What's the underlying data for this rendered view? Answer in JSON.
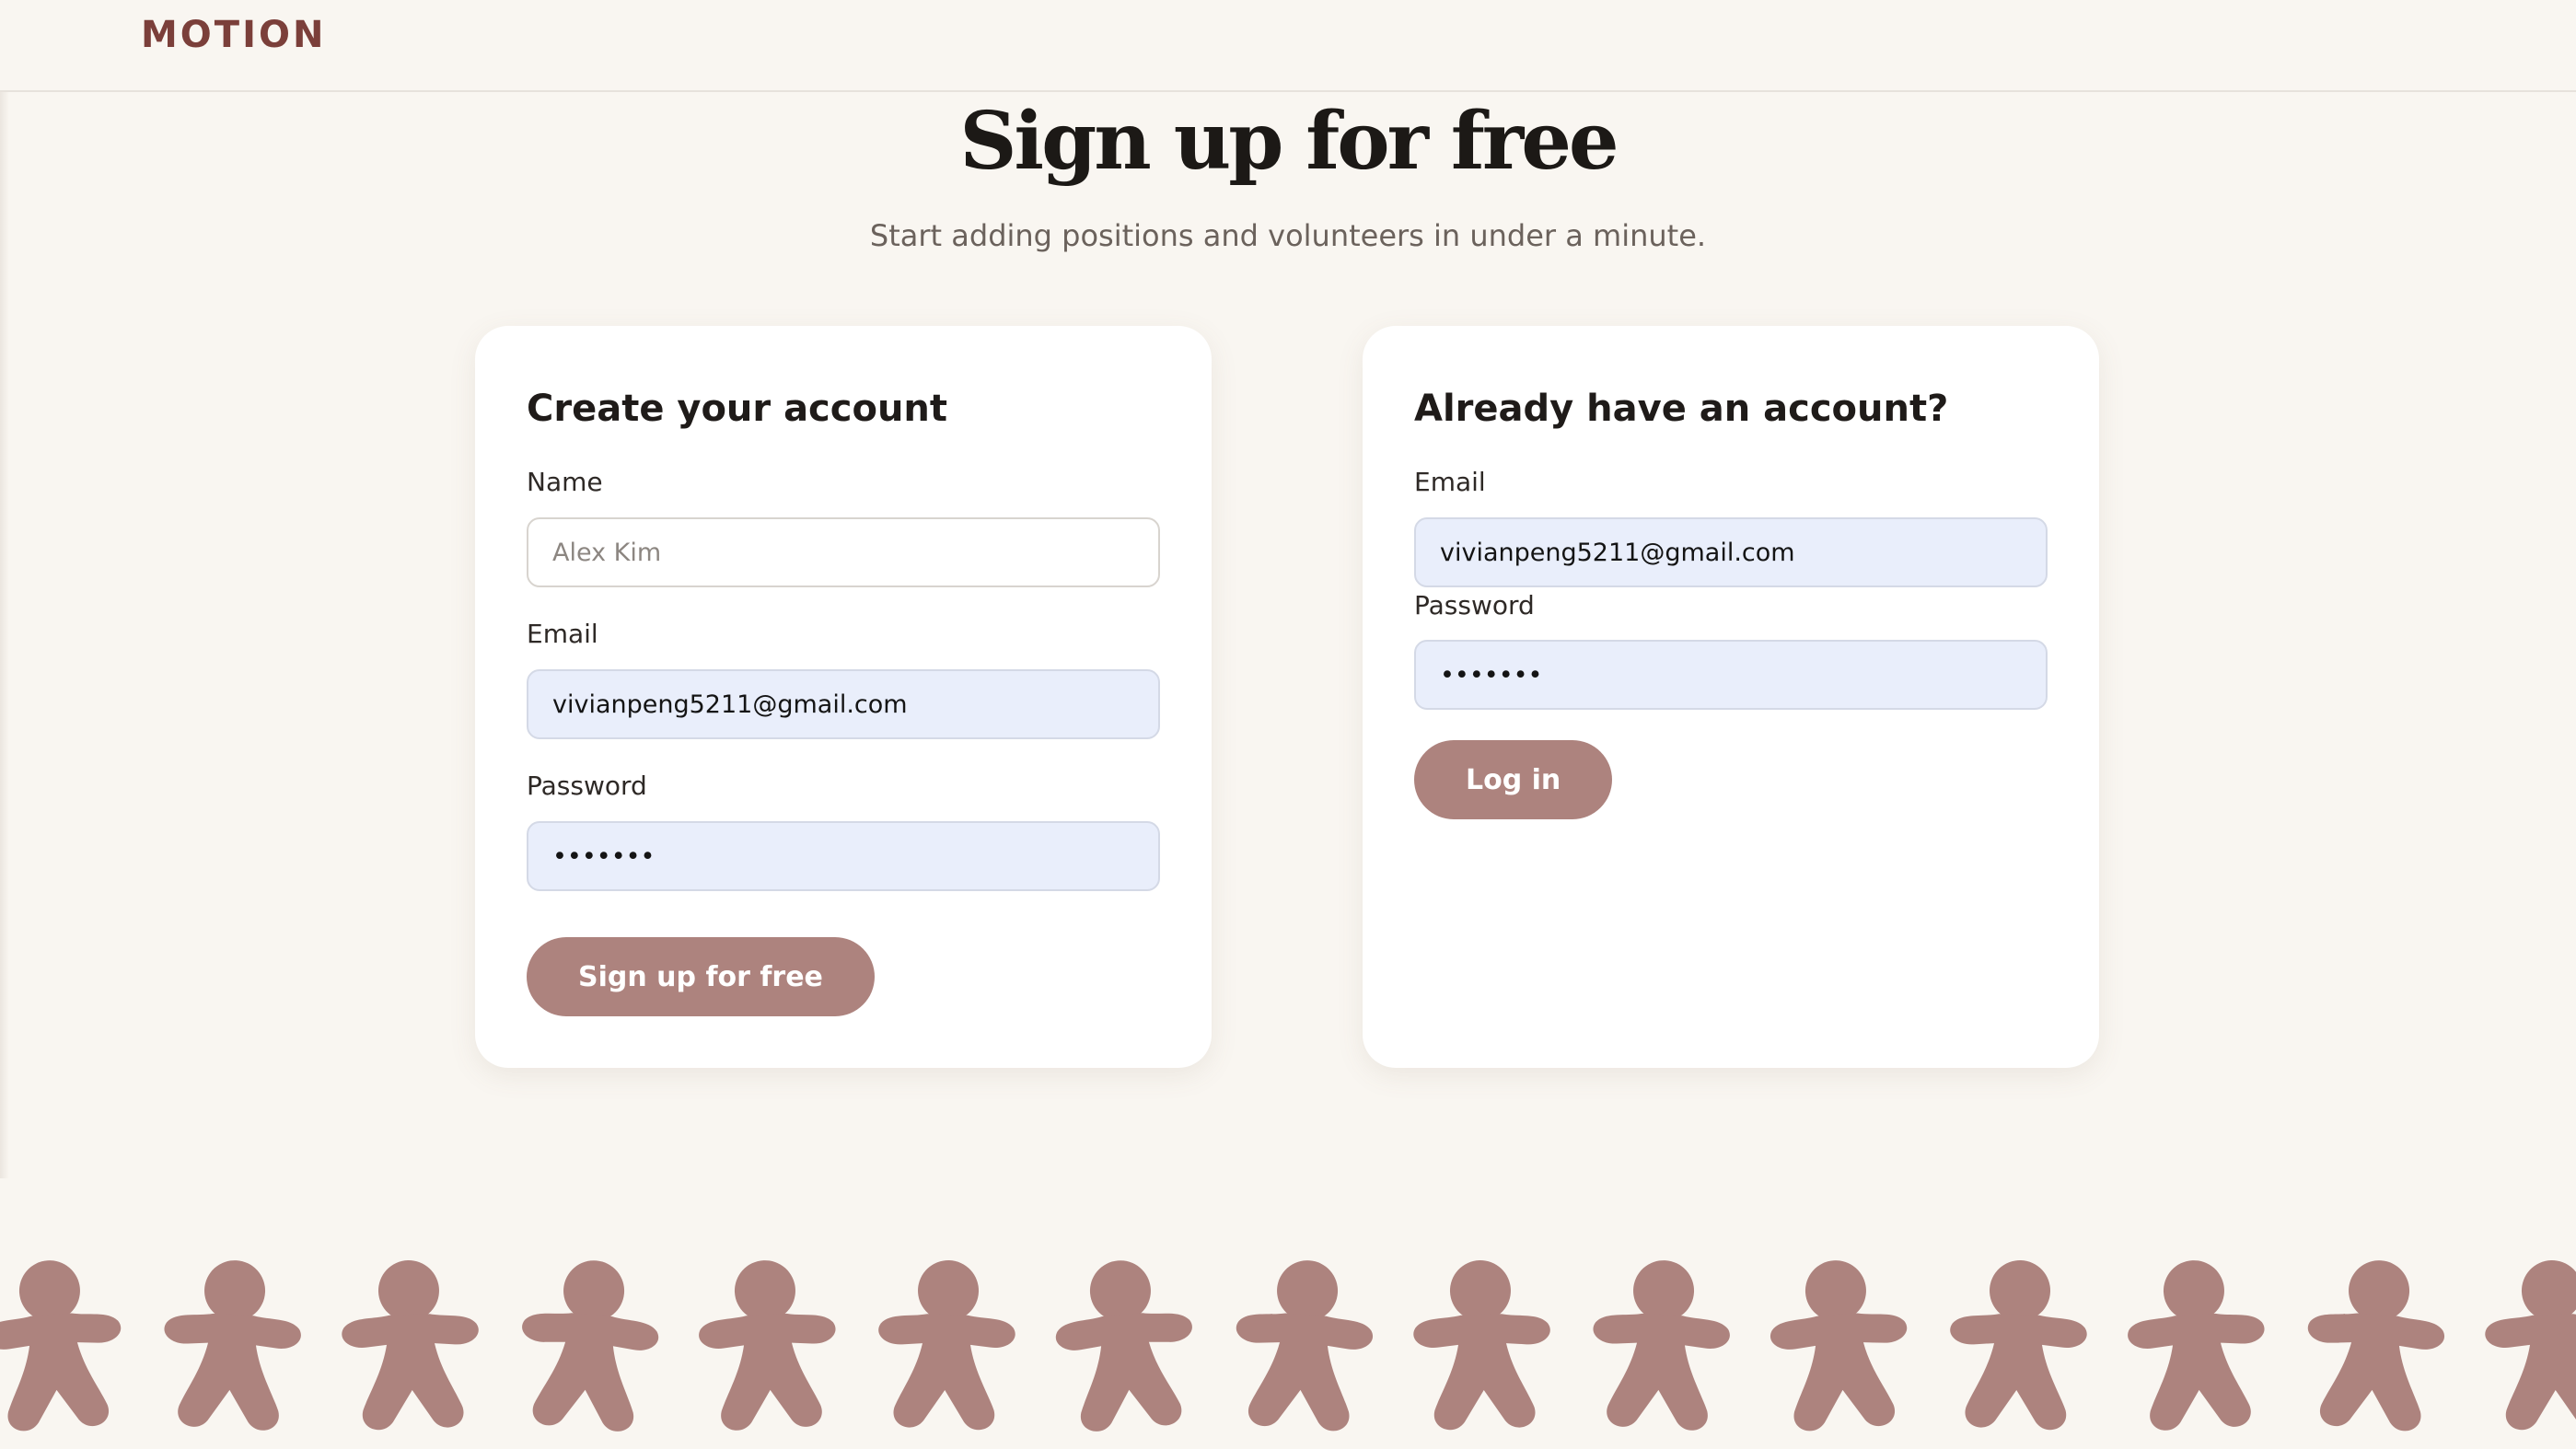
{
  "brand": {
    "logo_text": "MOTION",
    "logo_color": "#7b3f3a"
  },
  "header": {
    "title": "Sign up for free",
    "subtitle": "Start adding positions and volunteers in under a minute."
  },
  "signup": {
    "title": "Create your account",
    "name_label": "Name",
    "name_placeholder": "Alex Kim",
    "name_value": "",
    "email_label": "Email",
    "email_value": "vivianpeng5211@gmail.com",
    "password_label": "Password",
    "password_value": "1234567",
    "submit_label": "Sign up for free"
  },
  "login": {
    "title": "Already have an account?",
    "email_label": "Email",
    "email_value": "vivianpeng5211@gmail.com",
    "password_label": "Password",
    "password_value": "1234567",
    "submit_label": "Log in"
  },
  "decor": {
    "icon": "gingerbread-figure-icon",
    "count": 15,
    "color": "#ad837e"
  },
  "colors": {
    "background": "#f9f6f1",
    "button": "#ad837e",
    "autofill": "#e9eefb"
  }
}
